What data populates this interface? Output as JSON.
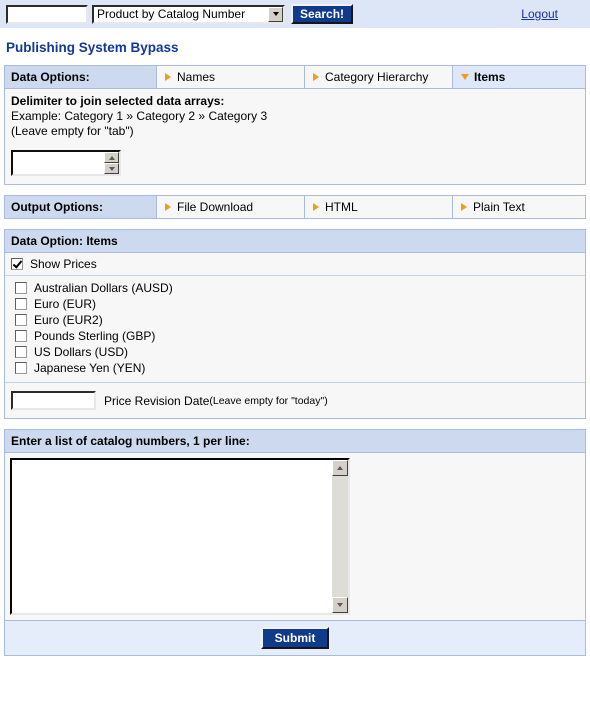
{
  "topbar": {
    "search_value": "",
    "search_placeholder": "",
    "search_type_selected": "Product by Catalog Number",
    "search_type_options": [
      "Product by Catalog Number"
    ],
    "search_button_label": "Search!",
    "logout_label": "Logout"
  },
  "page_title": "Publishing System Bypass",
  "data_options": {
    "head_label": "Data Options:",
    "tabs": [
      {
        "label": "Names",
        "active": false
      },
      {
        "label": "Category Hierarchy",
        "active": false
      },
      {
        "label": "Items",
        "active": true
      }
    ],
    "delimiter": {
      "title": "Delimiter to join selected data arrays:",
      "example": "Example: Category 1 » Category 2 » Category 3",
      "note": "(Leave empty for \"tab\")",
      "value": ""
    }
  },
  "output_options": {
    "head_label": "Output Options:",
    "tabs": [
      {
        "label": "File Download",
        "active": false
      },
      {
        "label": "HTML",
        "active": false
      },
      {
        "label": "Plain Text",
        "active": false
      }
    ]
  },
  "data_option_items": {
    "head_label": "Data Option: Items",
    "show_prices": {
      "label": "Show Prices",
      "checked": true
    },
    "currencies": [
      {
        "label": "Australian Dollars (AUSD)",
        "checked": false
      },
      {
        "label": "Euro (EUR)",
        "checked": false
      },
      {
        "label": "Euro (EUR2)",
        "checked": false
      },
      {
        "label": "Pounds Sterling (GBP)",
        "checked": false
      },
      {
        "label": "US Dollars (USD)",
        "checked": false
      },
      {
        "label": "Japanese Yen (YEN)",
        "checked": false
      }
    ],
    "price_revision_date": {
      "value": "",
      "label": "Price Revision Date",
      "note": "(Leave empty for \"today\")"
    }
  },
  "catalog_section": {
    "head_label": "Enter a list of catalog numbers, 1 per line:",
    "textarea_value": ""
  },
  "submit": {
    "label": "Submit"
  },
  "colors": {
    "accent_blue": "#103a8c",
    "title_blue": "#14379c",
    "header_band": "#ccd9ee",
    "panel_bg": "#f7f7f7",
    "tab_marker_orange": "#f29c1f",
    "link_blue": "#1a2ea8"
  }
}
